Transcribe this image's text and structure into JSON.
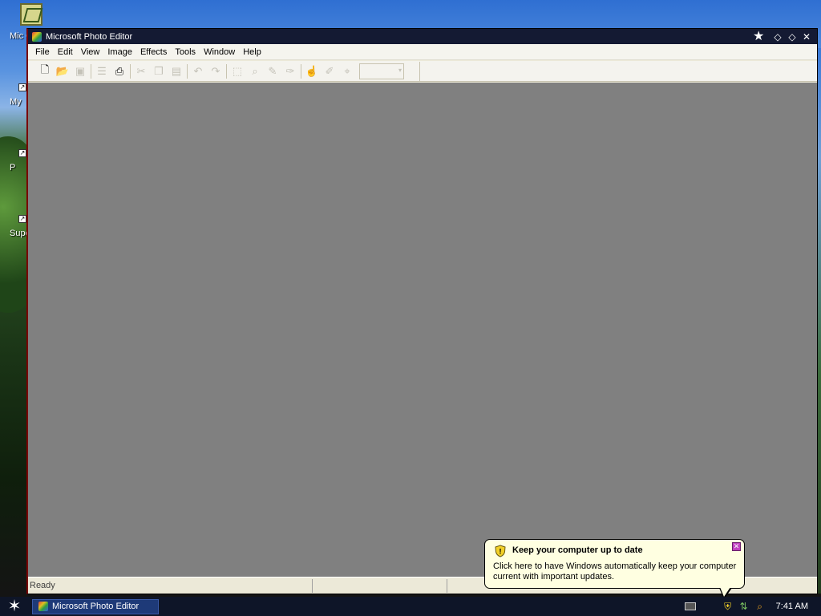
{
  "desktop": {
    "icons": [
      {
        "label": "Mic Ou"
      },
      {
        "label": "My"
      },
      {
        "label": "P"
      },
      {
        "label": "Supe"
      }
    ]
  },
  "window": {
    "title": "Microsoft Photo Editor",
    "menu": [
      "File",
      "Edit",
      "View",
      "Image",
      "Effects",
      "Tools",
      "Window",
      "Help"
    ],
    "toolbar": [
      {
        "icon": "new-icon",
        "enabled": true
      },
      {
        "icon": "open-icon",
        "enabled": true
      },
      {
        "icon": "save-icon",
        "enabled": false
      },
      {
        "icon": "scan-icon",
        "enabled": false
      },
      {
        "icon": "print-icon",
        "enabled": true
      },
      {
        "icon": "cut-icon",
        "enabled": false
      },
      {
        "icon": "copy-icon",
        "enabled": false
      },
      {
        "icon": "paste-icon",
        "enabled": false
      },
      {
        "icon": "undo-icon",
        "enabled": false
      },
      {
        "icon": "redo-icon",
        "enabled": false
      },
      {
        "icon": "select-icon",
        "enabled": false
      },
      {
        "icon": "crop-icon",
        "enabled": false
      },
      {
        "icon": "text-icon",
        "enabled": false
      },
      {
        "icon": "set-transparent-icon",
        "enabled": false
      },
      {
        "icon": "smudge-icon",
        "enabled": false
      },
      {
        "icon": "sharpen-icon",
        "enabled": false
      },
      {
        "icon": "zoom-icon",
        "enabled": false
      }
    ],
    "zoom_value": "",
    "status": "Ready"
  },
  "balloon": {
    "title": "Keep your computer up to date",
    "body": "Click here to have Windows automatically keep your computer current with important updates."
  },
  "taskbar": {
    "task_label": "Microsoft Photo Editor",
    "clock": "7:41 AM"
  },
  "colors": {
    "titlebar": "#141a33",
    "workspace": "#808080",
    "taskbar": "#0e1528",
    "balloon": "#ffffe1"
  }
}
